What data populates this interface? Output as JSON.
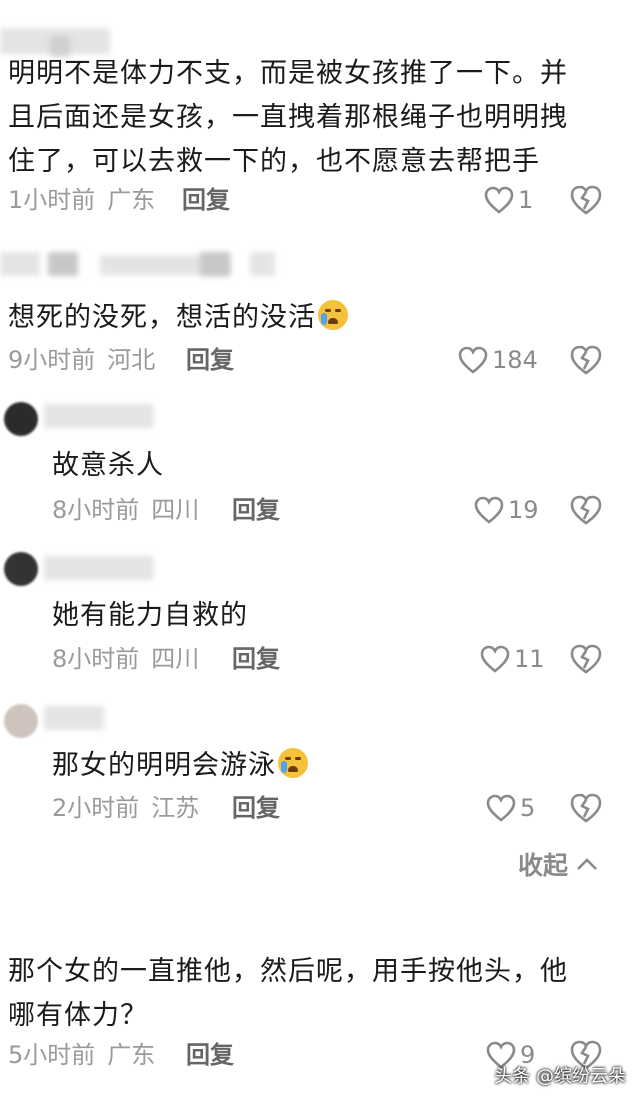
{
  "comments": [
    {
      "text_lines": [
        "明明不是体力不支，而是被女孩推了一下。并",
        "且后面还是女孩，一直拽着那根绳子也明明拽",
        "住了，可以去救一下的，也不愿意去帮把手"
      ],
      "time": "1小时前",
      "location": "广东",
      "reply": "回复",
      "likes": "1"
    },
    {
      "text": "想死的没死，想活的没活",
      "emoji": "crying-face",
      "time": "9小时前",
      "location": "河北",
      "reply": "回复",
      "likes": "184"
    },
    {
      "text": "故意杀人",
      "time": "8小时前",
      "location": "四川",
      "reply": "回复",
      "likes": "19"
    },
    {
      "text": "她有能力自救的",
      "time": "8小时前",
      "location": "四川",
      "reply": "回复",
      "likes": "11"
    },
    {
      "text": "那女的明明会游泳",
      "emoji": "crying-face",
      "time": "2小时前",
      "location": "江苏",
      "reply": "回复",
      "likes": "5"
    },
    {
      "text_lines": [
        "那个女的一直推他，然后呢，用手按他头，他",
        "哪有体力？"
      ],
      "time": "5小时前",
      "location": "广东",
      "reply": "回复",
      "likes": "9"
    }
  ],
  "collapse_label": "收起",
  "watermark": "头条 @缤纷云朵",
  "icons": {
    "like": "heart-outline-icon",
    "dislike": "broken-heart-icon",
    "collapse": "chevron-up-icon"
  },
  "colors": {
    "text": "#1b1b1b",
    "meta": "#9a9a9a",
    "icon": "#8a8a8a"
  }
}
